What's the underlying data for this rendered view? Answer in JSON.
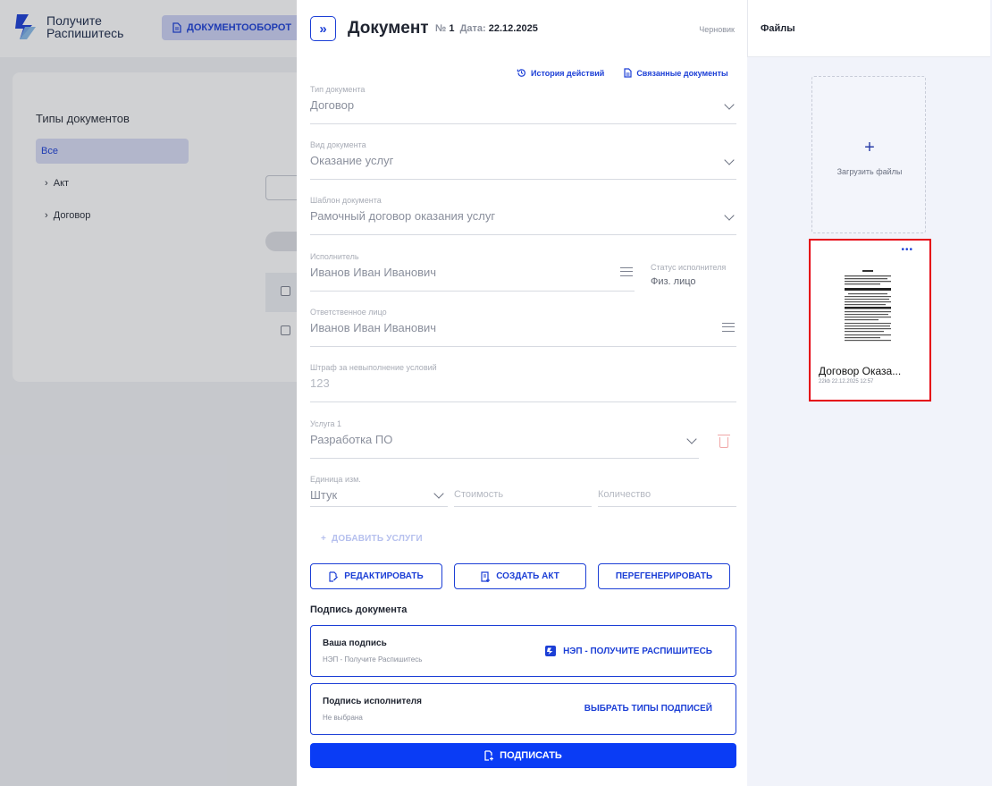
{
  "background": {
    "logo_line1": "Получите",
    "logo_line2": "Распишитесь",
    "nav_button": "ДОКУМЕНТООБОРОТ",
    "sidebar_title": "Типы документов",
    "filter_all": "Все",
    "tree": [
      "Акт",
      "Договор"
    ]
  },
  "document": {
    "title": "Документ",
    "number_label": "№",
    "number": "1",
    "date_label": "Дата:",
    "date": "22.12.2025",
    "status": "Черновик",
    "links": {
      "history": "История действий",
      "related": "Связанные документы"
    },
    "fields": {
      "doc_type": {
        "label": "Тип документа",
        "value": "Договор"
      },
      "doc_kind": {
        "label": "Вид документа",
        "value": "Оказание услуг"
      },
      "template": {
        "label": "Шаблон документа",
        "value": "Рамочный договор оказания услуг"
      },
      "executor": {
        "label": "Исполнитель",
        "value": "Иванов Иван Иванович"
      },
      "executor_status": {
        "label": "Статус исполнителя",
        "value": "Физ. лицо"
      },
      "responsible": {
        "label": "Ответственное лицо",
        "value": "Иванов Иван Иванович"
      },
      "penalty": {
        "label": "Штраф за невыполнение условий",
        "value": "123"
      },
      "service": {
        "label": "Услуга 1",
        "value": "Разработка ПО"
      },
      "unit": {
        "label": "Единица изм.",
        "value": "Штук"
      },
      "cost": {
        "placeholder": "Стоимость"
      },
      "quantity": {
        "placeholder": "Количество"
      }
    },
    "add_services": "ДОБАВИТЬ УСЛУГИ",
    "buttons": {
      "edit": "РЕДАКТИРОВАТЬ",
      "create_act": "СОЗДАТЬ АКТ",
      "regenerate": "ПЕРЕГЕНЕРИРОВАТЬ"
    },
    "signature": {
      "heading": "Подпись документа",
      "yours_title": "Ваша подпись",
      "yours_sub": "НЭП - Получите Распишитесь",
      "yours_action": "НЭП - ПОЛУЧИТЕ РАСПИШИТЕСЬ",
      "executor_title": "Подпись исполнителя",
      "executor_sub": "Не выбрана",
      "executor_action": "ВЫБРАТЬ ТИПЫ ПОДПИСЕЙ"
    },
    "sign_button": "ПОДПИСАТЬ"
  },
  "files": {
    "title": "Файлы",
    "upload_label": "Загрузить файлы",
    "items": [
      {
        "name": "Договор Оказа...",
        "meta": "22kb 22.12.2025 12:57"
      }
    ]
  },
  "colors": {
    "accent": "#1c3fd6",
    "primary_button": "#0a3cf5",
    "selection_border": "#e5000f"
  }
}
